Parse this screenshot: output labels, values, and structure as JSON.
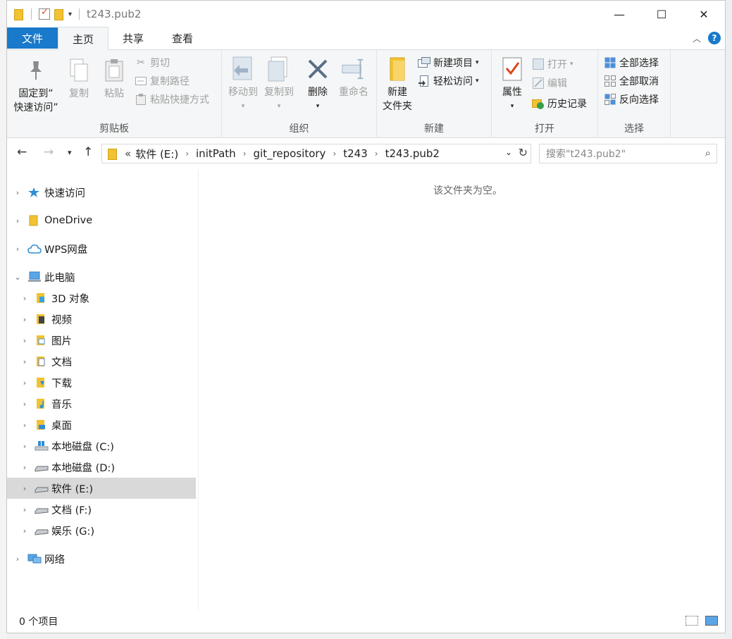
{
  "window": {
    "title": "t243.pub2",
    "controls": {
      "minimize": "—",
      "maximize": "☐",
      "close": "✕"
    }
  },
  "tabs": {
    "file": "文件",
    "home": "主页",
    "share": "共享",
    "view": "查看",
    "help": "?"
  },
  "ribbon": {
    "clipboard": {
      "label": "剪贴板",
      "pin": "固定到\"快速访问\"",
      "pin_line1": "固定到“",
      "pin_line2": "快速访问”",
      "copy": "复制",
      "paste": "粘贴",
      "cut": "剪切",
      "copy_path": "复制路径",
      "paste_shortcut": "粘贴快捷方式"
    },
    "organize": {
      "label": "组织",
      "move_to": "移动到",
      "copy_to": "复制到",
      "delete": "删除",
      "rename": "重命名"
    },
    "new": {
      "label": "新建",
      "new_folder_line1": "新建",
      "new_folder_line2": "文件夹",
      "new_item": "新建项目",
      "easy_access": "轻松访问"
    },
    "open": {
      "label": "打开",
      "properties": "属性",
      "open": "打开",
      "edit": "编辑",
      "history": "历史记录"
    },
    "select": {
      "label": "选择",
      "select_all": "全部选择",
      "select_none": "全部取消",
      "invert": "反向选择"
    }
  },
  "address": {
    "overflow": "«",
    "crumbs": [
      "软件 (E:)",
      "initPath",
      "git_repository",
      "t243",
      "t243.pub2"
    ],
    "search_placeholder": "搜索\"t243.pub2\""
  },
  "nav": {
    "quick_access": "快速访问",
    "onedrive": "OneDrive",
    "wps": "WPS网盘",
    "this_pc": "此电脑",
    "children": [
      "3D 对象",
      "视频",
      "图片",
      "文档",
      "下载",
      "音乐",
      "桌面",
      "本地磁盘 (C:)",
      "本地磁盘 (D:)",
      "软件 (E:)",
      "文档 (F:)",
      "娱乐 (G:)"
    ],
    "network": "网络"
  },
  "main": {
    "empty_message": "该文件夹为空。"
  },
  "status": {
    "item_count": "0 个项目"
  },
  "colors": {
    "accent": "#1979ca",
    "folder": "#f1c232",
    "selected_row": "#d9d9d9"
  }
}
